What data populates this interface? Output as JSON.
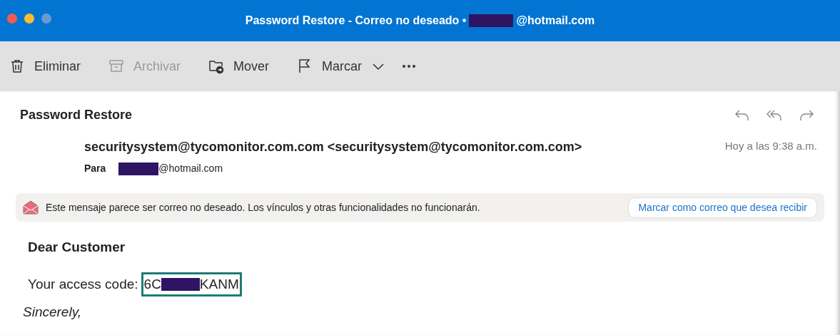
{
  "window": {
    "title_start": "Password Restore - Correo no deseado •",
    "title_end": "@hotmail.com"
  },
  "toolbar": [
    {
      "kind": "trash",
      "label": "Eliminar",
      "disabled": false
    },
    {
      "kind": "archive",
      "label": "Archivar",
      "disabled": true
    },
    {
      "kind": "move",
      "label": "Mover",
      "disabled": false
    },
    {
      "kind": "flag",
      "label": "Marcar",
      "disabled": false
    }
  ],
  "message": {
    "subject": "Password Restore",
    "from": "securitysystem@tycomonitor.com.com <securitysystem@tycomonitor.com.com>",
    "time": "Hoy a las 9:38 a.m.",
    "to_label": "Para",
    "to_end": "@hotmail.com"
  },
  "junk_banner": {
    "text": "Este mensaje parece ser correo no deseado. Los vínculos y otras funcionalidades no funcionarán.",
    "button": "Marcar como correo que desea recibir"
  },
  "body": {
    "greeting": "Dear Customer",
    "code_label": "Your access code:",
    "code_start": "6C",
    "code_end": "KANM",
    "closing": "Sincerely,"
  }
}
